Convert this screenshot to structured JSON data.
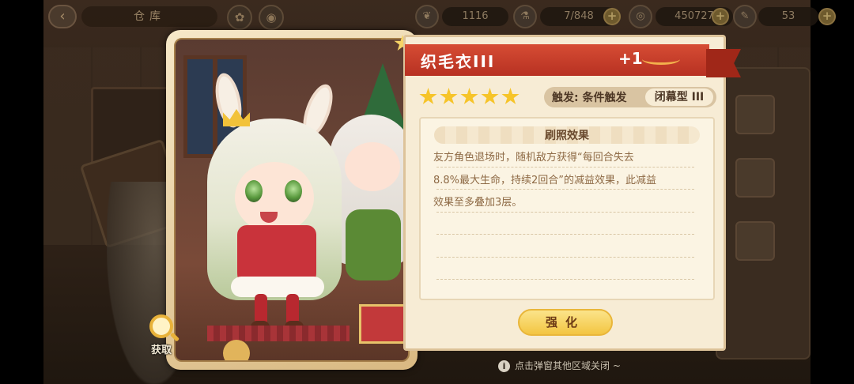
{
  "topbar": {
    "back_icon": "back-arrow-icon",
    "title": "仓库",
    "resources": [
      {
        "icon": "feather-icon",
        "value": "1116"
      },
      {
        "icon": "potion-icon",
        "value": "7/848"
      },
      {
        "icon": "coin-icon",
        "value": "450727"
      },
      {
        "icon": "carrot-icon",
        "value": "53"
      }
    ],
    "plus_label": "+"
  },
  "card": {
    "obtain_label": "获取"
  },
  "item": {
    "name": "织毛衣III",
    "level": "+1",
    "stars": 5,
    "trigger": "触发: 条件触发",
    "type": "闭幕型 III"
  },
  "effect": {
    "title": "刷照效果",
    "lines": [
      "友方角色退场时，随机敌方获得“每回合失去",
      "8.8%最大生命，持续2回合”的减益效果，此减益",
      "效果至多叠加3层。"
    ]
  },
  "actions": {
    "enhance_label": "强化"
  },
  "hint": {
    "icon": "info-icon",
    "text": "点击弹窗其他区域关闭 ~"
  },
  "colors": {
    "ribbon": "#c93c2a",
    "panel": "#f7ecd5",
    "star": "#f6c429",
    "button": "#f3c542"
  }
}
